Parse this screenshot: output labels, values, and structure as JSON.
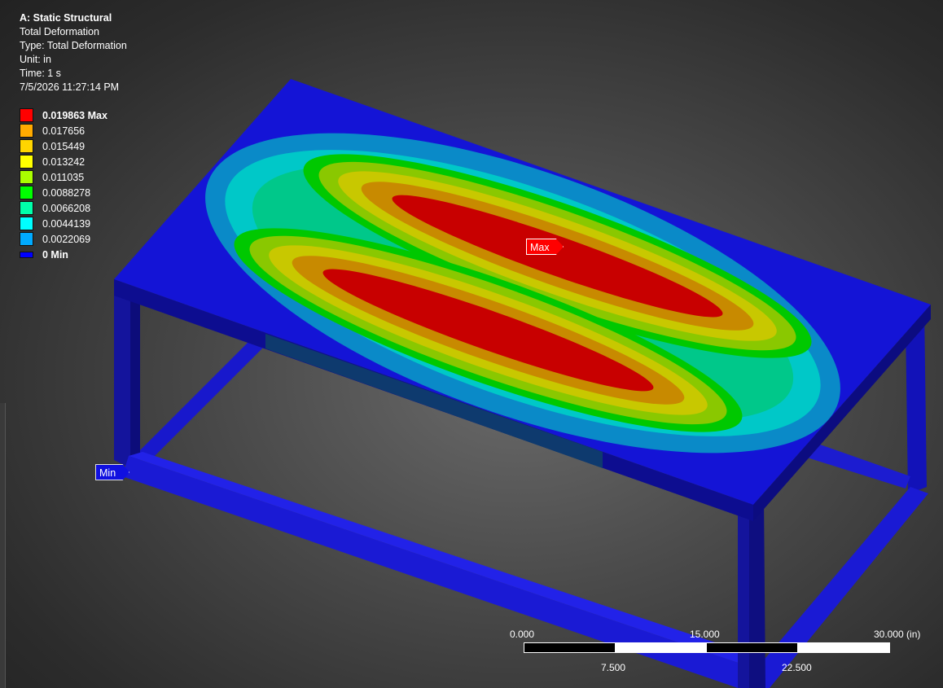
{
  "info": {
    "title": "A: Static Structural",
    "result": "Total Deformation",
    "type": "Type: Total Deformation",
    "unit": "Unit: in",
    "time": "Time: 1 s",
    "timestamp": "7/5/2026 11:27:14 PM"
  },
  "legend": {
    "entries": [
      {
        "label": "0.019863 Max",
        "color": "#ff0000"
      },
      {
        "label": "0.017656",
        "color": "#ffaa00"
      },
      {
        "label": "0.015449",
        "color": "#ffd500"
      },
      {
        "label": "0.013242",
        "color": "#ffff00"
      },
      {
        "label": "0.011035",
        "color": "#aaff00"
      },
      {
        "label": "0.0088278",
        "color": "#00ff00"
      },
      {
        "label": "0.0066208",
        "color": "#00ffaa"
      },
      {
        "label": "0.0044139",
        "color": "#00ffff"
      },
      {
        "label": "0.0022069",
        "color": "#00aaff"
      }
    ],
    "min_label": "0 Min",
    "min_color": "#0000ff"
  },
  "probes": {
    "max": "Max",
    "min": "Min"
  },
  "scale_bar": {
    "top_ticks": [
      "0.000",
      "15.000",
      "30.000 (in)"
    ],
    "bottom_ticks": [
      "7.500",
      "22.500"
    ]
  },
  "colors": {
    "structure": "#1a1ad8",
    "contour_red": "#c80000",
    "contour_orange": "#c88a00",
    "contour_yellow": "#c8c800",
    "contour_lime": "#8ac800",
    "contour_green": "#00c800",
    "contour_teal": "#00c88a",
    "contour_cyan": "#00c8c8",
    "contour_lightblue": "#0a8ac8"
  }
}
